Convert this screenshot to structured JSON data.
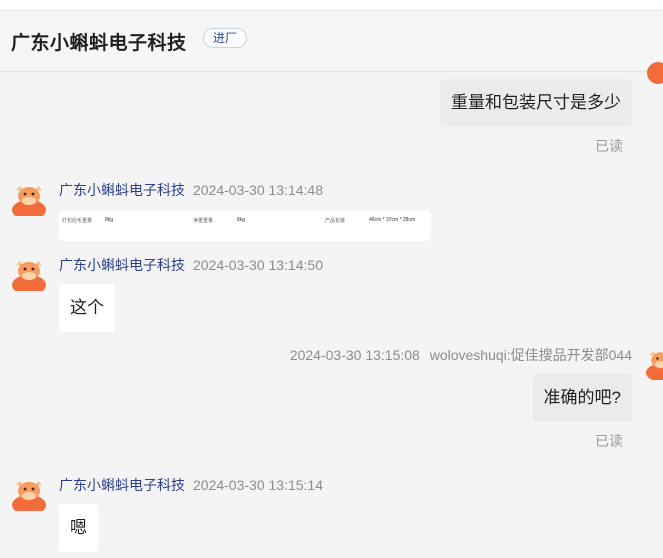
{
  "header": {
    "title": "广东小蝌蚪电子科技",
    "tag": "进厂"
  },
  "messages": {
    "m1": {
      "text": "重量和包装尺寸是多少",
      "status": "已读"
    },
    "m2": {
      "sender": "广东小蝌蚪电子科技",
      "time": "2024-03-30 13:14:48",
      "table": {
        "label1": "打包后毛重量",
        "value1": "8kg",
        "label2": "净重重量",
        "value2": "8kg",
        "label3": "产品包装",
        "value3": "46cm * 37cm * 28cm"
      }
    },
    "m3": {
      "sender": "广东小蝌蚪电子科技",
      "time": "2024-03-30 13:14:50",
      "text": "这个"
    },
    "m4": {
      "time": "2024-03-30 13:15:08",
      "sender": "woloveshuqi:促佳搜品开发部044",
      "text": "准确的吧?",
      "status": "已读"
    },
    "m5": {
      "sender": "广东小蝌蚪电子科技",
      "time": "2024-03-30 13:15:14",
      "text": "嗯"
    }
  },
  "icons": {
    "avatar": "cartoon-bull-avatar-icon"
  },
  "colors": {
    "accent_name": "#2c3f8f",
    "avatar_orange": "#f26b3a",
    "bubble_out": "#ebebeb",
    "bubble_in": "#ffffff"
  }
}
